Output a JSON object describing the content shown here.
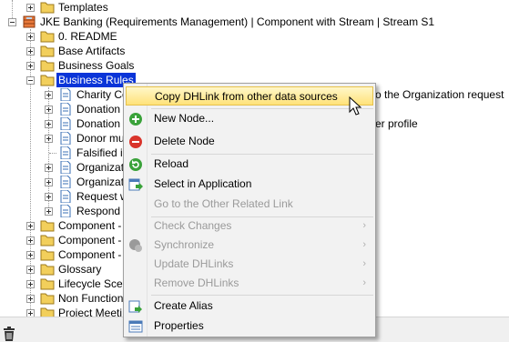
{
  "tree": {
    "templates": "Templates",
    "project": "JKE Banking (Requirements Management) | Component with Stream | Stream S1",
    "readme": "0. README",
    "base_artifacts": "Base Artifacts",
    "business_goals": "Business Goals",
    "business_rules": "Business Rules",
    "children": [
      "Charity Co",
      "Donation",
      "Donation",
      "Donor mu",
      "Falsified in",
      "Organizat",
      "Organizat",
      "Request w",
      "Respond t"
    ],
    "right_text_1": "o the Organization request",
    "right_text_2": "er profile",
    "after": [
      "Component -",
      "Component -",
      "Component -",
      "Glossary",
      "Lifecycle Scen",
      "Non Function",
      "Project Meeti"
    ]
  },
  "context_menu": {
    "items": {
      "copy_dhlink": "Copy DHLink from other data sources",
      "new_node": "New Node...",
      "delete_node": "Delete Node",
      "reload": "Reload",
      "select_in_app": "Select in Application",
      "go_to_other": "Go to the Other Related Link",
      "check_changes": "Check Changes",
      "synchronize": "Synchronize",
      "update_dhlinks": "Update DHLinks",
      "remove_dhlinks": "Remove DHLinks",
      "create_alias": "Create Alias",
      "properties": "Properties"
    },
    "submenu_arrow": "›"
  },
  "colors": {
    "selection": "#0a34d8",
    "folder": "#f2cf5b",
    "highlight": "#ffe27a"
  }
}
